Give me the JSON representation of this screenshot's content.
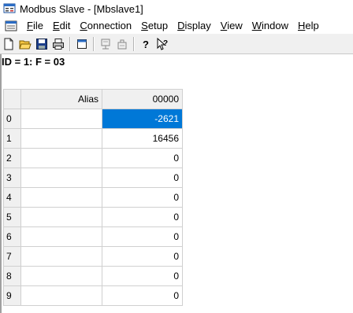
{
  "window": {
    "title": "Modbus Slave - [Mbslave1]"
  },
  "menu": {
    "items": [
      {
        "accel": "F",
        "rest": "ile"
      },
      {
        "accel": "E",
        "rest": "dit"
      },
      {
        "accel": "C",
        "rest": "onnection"
      },
      {
        "accel": "S",
        "rest": "etup"
      },
      {
        "accel": "D",
        "rest": "isplay"
      },
      {
        "accel": "V",
        "rest": "iew"
      },
      {
        "accel": "W",
        "rest": "indow"
      },
      {
        "accel": "H",
        "rest": "elp"
      }
    ]
  },
  "toolbar": {
    "icons": [
      "new-icon",
      "open-icon",
      "save-icon",
      "print-icon",
      "window-icon",
      "connect-icon",
      "disconnect-icon",
      "help-icon",
      "context-help-icon"
    ]
  },
  "info": {
    "text": "ID = 1: F = 03"
  },
  "grid": {
    "headers": {
      "alias": "Alias",
      "address": "00000"
    },
    "rows": [
      {
        "index": "0",
        "alias": "",
        "value": "-2621"
      },
      {
        "index": "1",
        "alias": "",
        "value": "16456"
      },
      {
        "index": "2",
        "alias": "",
        "value": "0"
      },
      {
        "index": "3",
        "alias": "",
        "value": "0"
      },
      {
        "index": "4",
        "alias": "",
        "value": "0"
      },
      {
        "index": "5",
        "alias": "",
        "value": "0"
      },
      {
        "index": "6",
        "alias": "",
        "value": "0"
      },
      {
        "index": "7",
        "alias": "",
        "value": "0"
      },
      {
        "index": "8",
        "alias": "",
        "value": "0"
      },
      {
        "index": "9",
        "alias": "",
        "value": "0"
      }
    ]
  },
  "colors": {
    "selection": "#0078d7",
    "toolbar_bg": "#f0f0f0"
  }
}
